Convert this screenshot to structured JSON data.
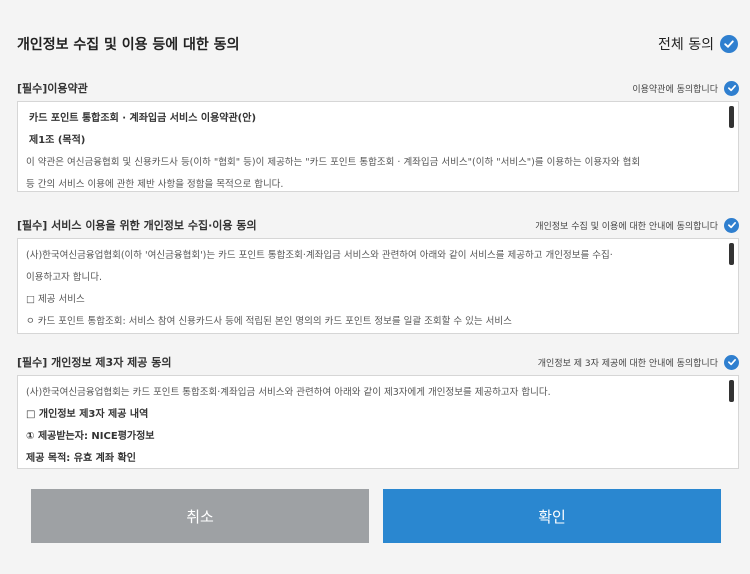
{
  "header": {
    "title": "개인정보 수집 및 이용 등에 대한 동의",
    "all_agree_label": "전체 동의"
  },
  "sections": [
    {
      "title": "[필수]이용약관",
      "agree_text": "이용약관에 동의합니다",
      "lines": [
        "카드 포인트 통합조회 · 계좌입금 서비스 이용약관(안)",
        "제1조 (목적)",
        "이 약관은 여신금융협회 및 신용카드사 등(이하 \"협회\" 등)이 제공하는 \"카드 포인트 통합조회 · 계좌입금 서비스\"(이하 \"서비스\")를 이용하는 이용자와 협회",
        "등 간의 서비스 이용에 관한 제반 사항을 정함을 목적으로 합니다."
      ]
    },
    {
      "title": "[필수] 서비스 이용을 위한 개인정보 수집·이용 동의",
      "agree_text": "개인정보 수집 및 이용에 대한 안내에 동의합니다",
      "lines": [
        "(사)한국여신금융업협회(이하 '여신금융협회')는 카드 포인트 통합조회·계좌입금 서비스와 관련하여 아래와 같이 서비스를 제공하고 개인정보를 수집·",
        "이용하고자 합니다.",
        "□ 제공 서비스",
        "ㅇ 카드 포인트 통합조회: 서비스 참여 신용카드사 등에 적립된 본인 명의의 카드 포인트 정보를 일괄 조회할 수 있는 서비스"
      ]
    },
    {
      "title": "[필수] 개인정보 제3자 제공 동의",
      "agree_text": "개인정보 제 3자 제공에 대한 안내에 동의합니다",
      "lines": [
        "(사)한국여신금융업협회는 카드 포인트 통합조회·계좌입금 서비스와 관련하여 아래와 같이 제3자에게 개인정보를 제공하고자 합니다.",
        "□ 개인정보 제3자 제공 내역",
        "① 제공받는자: NICE평가정보",
        "제공 목적: 유효 계좌 확인"
      ]
    }
  ],
  "buttons": {
    "cancel": "취소",
    "confirm": "확인"
  },
  "colors": {
    "accent": "#2a87d0",
    "cancel_bg": "#9ea1a4",
    "check": "#2f7fcf"
  },
  "icons": {
    "all_agree": "check-circle-icon",
    "section_agree": "check-circle-icon"
  }
}
